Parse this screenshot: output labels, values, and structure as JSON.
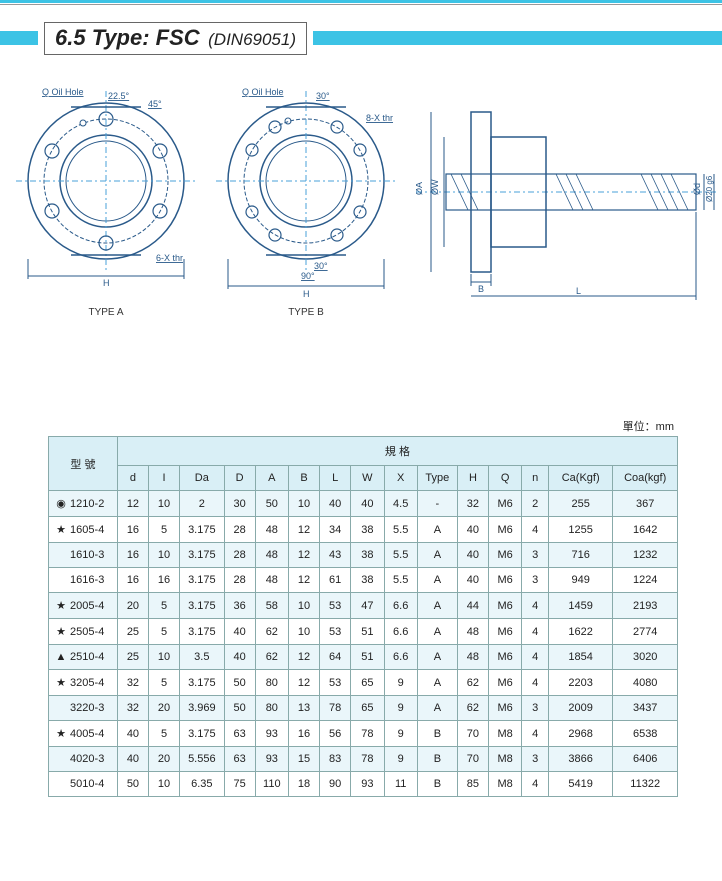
{
  "title": {
    "main": "6.5 Type: FSC",
    "sub": "(DIN69051)"
  },
  "unit_label": "單位：mm",
  "drawings": {
    "typeA": {
      "label": "TYPE A",
      "annotations": {
        "oilhole": "Q Oil Hole",
        "a225": "22.5°",
        "a45": "45°",
        "thr": "6-X thr",
        "H": "H"
      }
    },
    "typeB": {
      "label": "TYPE B",
      "annotations": {
        "oilhole": "Q Oil Hole",
        "a30a": "30°",
        "thr": "8-X thr",
        "a30b": "30°",
        "a90": "90°",
        "H": "H"
      }
    },
    "side": {
      "annotations": {
        "da": "ØA",
        "dw": "ØW",
        "B": "B",
        "L": "L",
        "dd": "Ød",
        "dg6": "Ø20 g6"
      }
    }
  },
  "table": {
    "group_model": "型 號",
    "group_spec": "規 格",
    "cols": [
      "d",
      "I",
      "Da",
      "D",
      "A",
      "B",
      "L",
      "W",
      "X",
      "Type",
      "H",
      "Q",
      "n",
      "Ca(Kgf)",
      "Coa(kgf)"
    ],
    "rows": [
      {
        "sym": "◉",
        "model": "1210-2",
        "d": "12",
        "I": "10",
        "Da": "2",
        "D": "30",
        "A": "50",
        "B": "10",
        "L": "40",
        "W": "40",
        "X": "4.5",
        "Type": "-",
        "H": "32",
        "Q": "M6",
        "n": "2",
        "Ca": "255",
        "Coa": "367"
      },
      {
        "sym": "★",
        "model": "1605-4",
        "d": "16",
        "I": "5",
        "Da": "3.175",
        "D": "28",
        "A": "48",
        "B": "12",
        "L": "34",
        "W": "38",
        "X": "5.5",
        "Type": "A",
        "H": "40",
        "Q": "M6",
        "n": "4",
        "Ca": "1255",
        "Coa": "1642"
      },
      {
        "sym": "",
        "model": "1610-3",
        "d": "16",
        "I": "10",
        "Da": "3.175",
        "D": "28",
        "A": "48",
        "B": "12",
        "L": "43",
        "W": "38",
        "X": "5.5",
        "Type": "A",
        "H": "40",
        "Q": "M6",
        "n": "3",
        "Ca": "716",
        "Coa": "1232"
      },
      {
        "sym": "",
        "model": "1616-3",
        "d": "16",
        "I": "16",
        "Da": "3.175",
        "D": "28",
        "A": "48",
        "B": "12",
        "L": "61",
        "W": "38",
        "X": "5.5",
        "Type": "A",
        "H": "40",
        "Q": "M6",
        "n": "3",
        "Ca": "949",
        "Coa": "1224"
      },
      {
        "sym": "★",
        "model": "2005-4",
        "d": "20",
        "I": "5",
        "Da": "3.175",
        "D": "36",
        "A": "58",
        "B": "10",
        "L": "53",
        "W": "47",
        "X": "6.6",
        "Type": "A",
        "H": "44",
        "Q": "M6",
        "n": "4",
        "Ca": "1459",
        "Coa": "2193"
      },
      {
        "sym": "★",
        "model": "2505-4",
        "d": "25",
        "I": "5",
        "Da": "3.175",
        "D": "40",
        "A": "62",
        "B": "10",
        "L": "53",
        "W": "51",
        "X": "6.6",
        "Type": "A",
        "H": "48",
        "Q": "M6",
        "n": "4",
        "Ca": "1622",
        "Coa": "2774"
      },
      {
        "sym": "▲",
        "model": "2510-4",
        "d": "25",
        "I": "10",
        "Da": "3.5",
        "D": "40",
        "A": "62",
        "B": "12",
        "L": "64",
        "W": "51",
        "X": "6.6",
        "Type": "A",
        "H": "48",
        "Q": "M6",
        "n": "4",
        "Ca": "1854",
        "Coa": "3020"
      },
      {
        "sym": "★",
        "model": "3205-4",
        "d": "32",
        "I": "5",
        "Da": "3.175",
        "D": "50",
        "A": "80",
        "B": "12",
        "L": "53",
        "W": "65",
        "X": "9",
        "Type": "A",
        "H": "62",
        "Q": "M6",
        "n": "4",
        "Ca": "2203",
        "Coa": "4080"
      },
      {
        "sym": "",
        "model": "3220-3",
        "d": "32",
        "I": "20",
        "Da": "3.969",
        "D": "50",
        "A": "80",
        "B": "13",
        "L": "78",
        "W": "65",
        "X": "9",
        "Type": "A",
        "H": "62",
        "Q": "M6",
        "n": "3",
        "Ca": "2009",
        "Coa": "3437"
      },
      {
        "sym": "★",
        "model": "4005-4",
        "d": "40",
        "I": "5",
        "Da": "3.175",
        "D": "63",
        "A": "93",
        "B": "16",
        "L": "56",
        "W": "78",
        "X": "9",
        "Type": "B",
        "H": "70",
        "Q": "M8",
        "n": "4",
        "Ca": "2968",
        "Coa": "6538"
      },
      {
        "sym": "",
        "model": "4020-3",
        "d": "40",
        "I": "20",
        "Da": "5.556",
        "D": "63",
        "A": "93",
        "B": "15",
        "L": "83",
        "W": "78",
        "X": "9",
        "Type": "B",
        "H": "70",
        "Q": "M8",
        "n": "3",
        "Ca": "3866",
        "Coa": "6406"
      },
      {
        "sym": "",
        "model": "5010-4",
        "d": "50",
        "I": "10",
        "Da": "6.35",
        "D": "75",
        "A": "110",
        "B": "18",
        "L": "90",
        "W": "93",
        "X": "11",
        "Type": "B",
        "H": "85",
        "Q": "M8",
        "n": "4",
        "Ca": "5419",
        "Coa": "11322"
      }
    ]
  }
}
